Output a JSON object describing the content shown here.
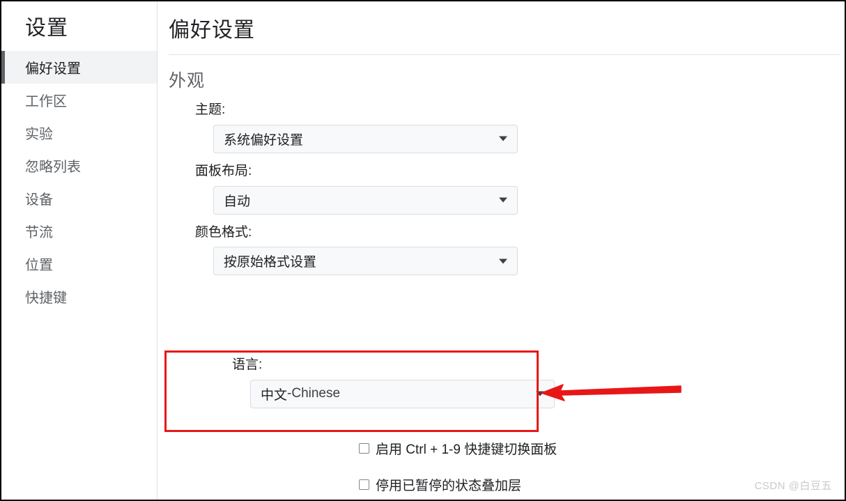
{
  "window": {
    "border_color": "#000000",
    "background": "#ffffff"
  },
  "sidebar": {
    "title": "设置",
    "selected_index": 0,
    "indicator_color": "#5f6368",
    "selected_background": "#f1f3f4",
    "items": [
      {
        "label": "偏好设置"
      },
      {
        "label": "工作区"
      },
      {
        "label": "实验"
      },
      {
        "label": "忽略列表"
      },
      {
        "label": "设备"
      },
      {
        "label": "节流"
      },
      {
        "label": "位置"
      },
      {
        "label": "快捷键"
      }
    ]
  },
  "main": {
    "page_title": "偏好设置",
    "section_title": "外观",
    "fields": [
      {
        "label": "主题:",
        "value": "系统偏好设置",
        "control": "dropdown",
        "arrow_icon": "chevron-down-icon"
      },
      {
        "label": "面板布局:",
        "value": "自动",
        "control": "dropdown",
        "arrow_icon": "chevron-down-icon"
      },
      {
        "label": "颜色格式:",
        "value": "按原始格式设置",
        "control": "dropdown",
        "arrow_icon": "chevron-down-icon"
      }
    ],
    "language_field": {
      "label": "语言:",
      "value_native": "中文",
      "value_separator": " - ",
      "value_english": "Chinese",
      "control": "dropdown",
      "arrow_icon": "chevron-down-icon"
    },
    "checkboxes": [
      {
        "label": "启用 Ctrl + 1-9 快捷键切换面板",
        "checked": false
      },
      {
        "label": "停用已暂停的状态叠加层",
        "checked": false
      }
    ]
  },
  "annotations": {
    "highlight_box": {
      "color": "#e81717",
      "thickness_px": 3,
      "target": "语言:"
    },
    "arrow": {
      "color": "#e81717",
      "direction": "left",
      "points_at": "语言下拉框"
    }
  },
  "watermark": {
    "text": "CSDN @白豆五",
    "color": "#c9c9c9"
  }
}
